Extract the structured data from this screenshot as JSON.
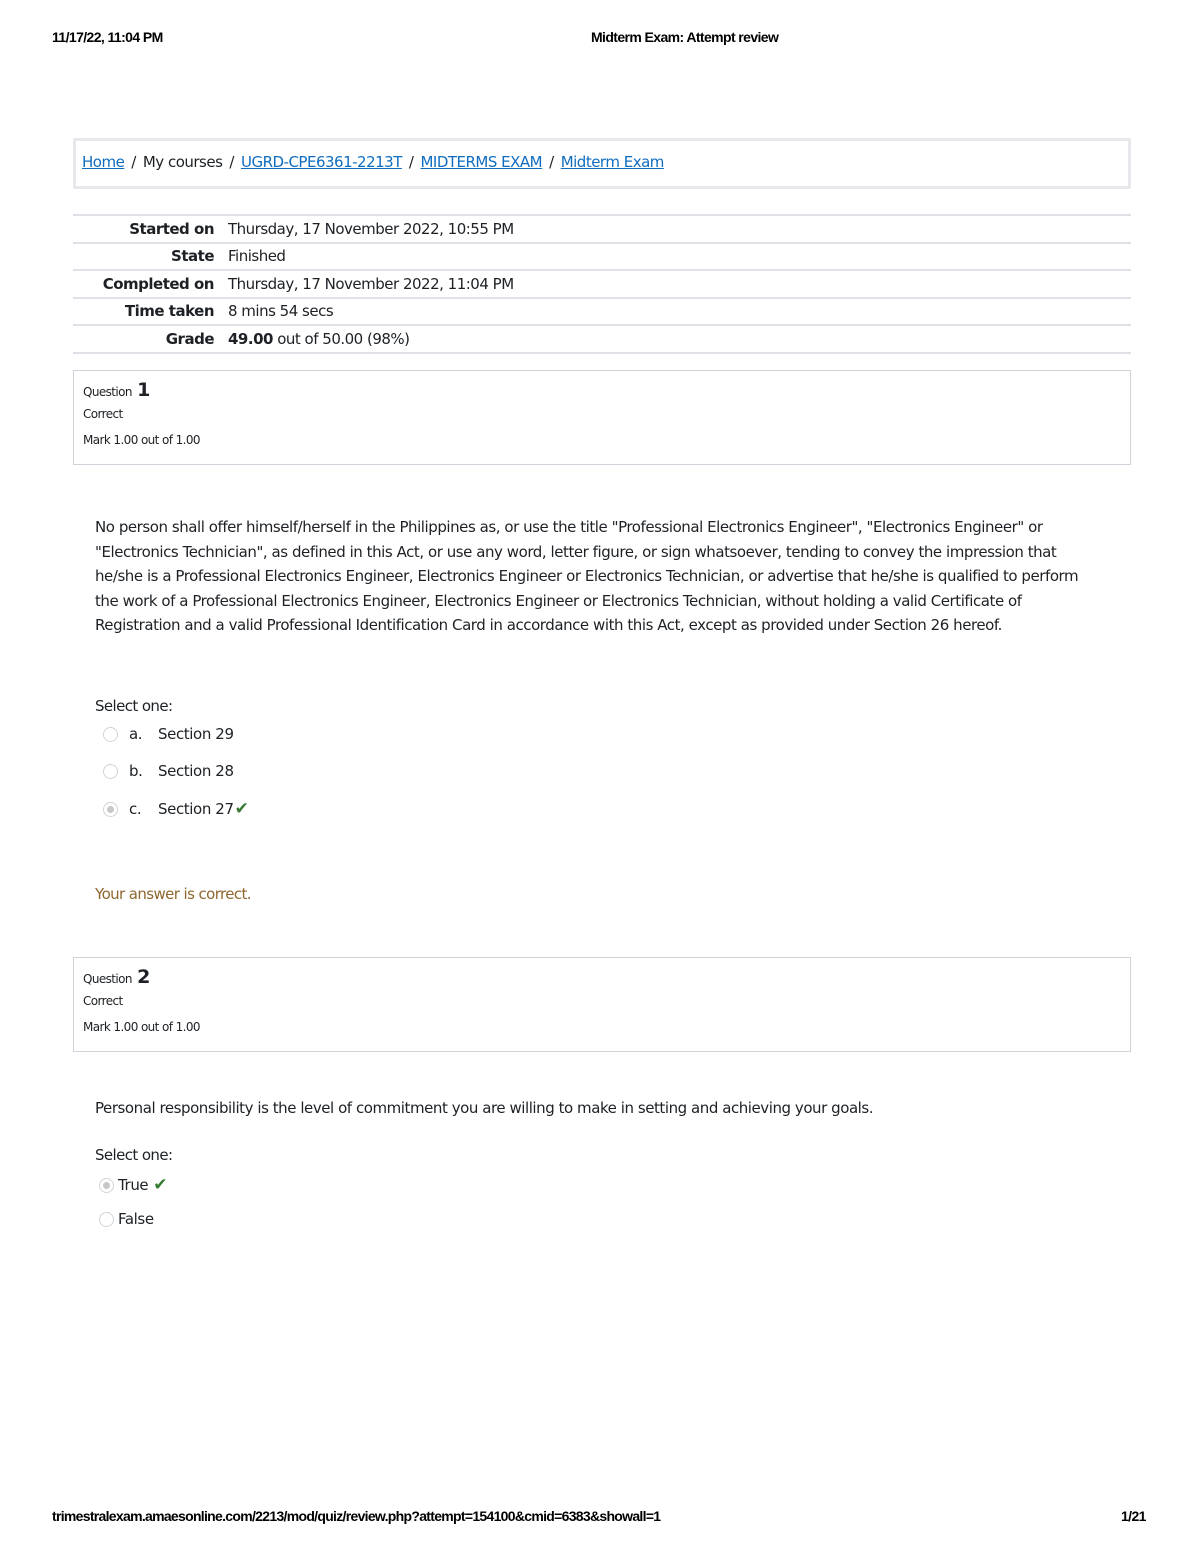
{
  "print_header": {
    "datetime": "11/17/22, 11:04 PM",
    "title": "Midterm Exam: Attempt review"
  },
  "breadcrumb": [
    {
      "label": "Home",
      "link": true
    },
    {
      "label": "My courses",
      "link": false
    },
    {
      "label": "UGRD-CPE6361-2213T",
      "link": true
    },
    {
      "label": "MIDTERMS EXAM",
      "link": true
    },
    {
      "label": "Midterm Exam",
      "link": true
    }
  ],
  "breadcrumb_separator": "/",
  "summary": {
    "started_on": {
      "label": "Started on",
      "value": "Thursday, 17 November 2022, 10:55 PM"
    },
    "state": {
      "label": "State",
      "value": "Finished"
    },
    "completed_on": {
      "label": "Completed on",
      "value": "Thursday, 17 November 2022, 11:04 PM"
    },
    "time_taken": {
      "label": "Time taken",
      "value": "8 mins 54 secs"
    },
    "grade": {
      "label": "Grade",
      "score": "49.00",
      "rest": " out of 50.00 (98%)"
    }
  },
  "questions": [
    {
      "label": "Question",
      "number": "1",
      "state": "Correct",
      "mark": "Mark 1.00 out of 1.00",
      "text": "No person shall offer himself/herself in the Philippines as, or use the title \"Professional Electronics Engineer\", \"Electronics Engineer\" or \"Electronics Technician\", as defined in this Act, or use any word, letter figure, or sign whatsoever, tending to convey the impression that he/she is a Professional Electronics Engineer, Electronics Engineer or Electronics Technician, or advertise that he/she is qualified to perform the work of a Professional Electronics Engineer, Electronics Engineer or Electronics Technician, without holding a valid Certificate of Registration and a valid Professional Identification Card in accordance with this Act, except as provided under Section 26 hereof.",
      "prompt": "Select one:",
      "answers": [
        {
          "letter": "a.",
          "text": "Section 29",
          "selected": false,
          "correct_mark": false
        },
        {
          "letter": "b.",
          "text": "Section 28",
          "selected": false,
          "correct_mark": false
        },
        {
          "letter": "c.",
          "text": "Section 27",
          "selected": true,
          "correct_mark": true
        }
      ],
      "feedback": "Your answer is correct."
    },
    {
      "label": "Question",
      "number": "2",
      "state": "Correct",
      "mark": "Mark 1.00 out of 1.00",
      "text": "Personal responsibility is the level of commitment you are willing to make in setting and achieving your goals.",
      "prompt": "Select one:",
      "answers": [
        {
          "text": "True",
          "selected": true,
          "correct_mark": true
        },
        {
          "text": "False",
          "selected": false,
          "correct_mark": false
        }
      ]
    }
  ],
  "icons": {
    "check": "✔"
  },
  "colors": {
    "link": "#0f6cbf",
    "correct": "#357a32",
    "feedback": "#8e662e"
  },
  "print_footer": {
    "url": "trimestralexam.amaesonline.com/2213/mod/quiz/review.php?attempt=154100&cmid=6383&showall=1",
    "page": "1/21"
  }
}
